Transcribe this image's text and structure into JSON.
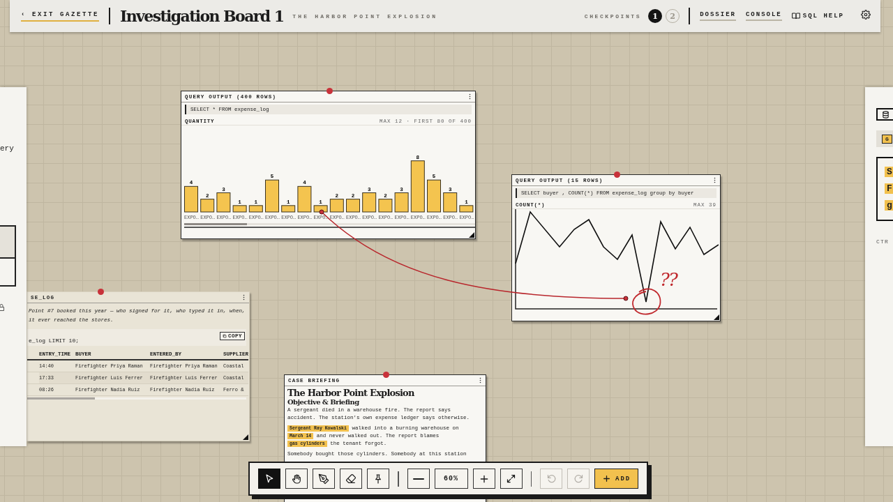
{
  "top_bar": {
    "back_link": "‹ EXIT GAZETTE",
    "title": "Investigation Board 1",
    "subtitle": "THE HARBOR POINT EXPLOSION",
    "checkpoints_label": "CHECKPOINTS",
    "checkpoints": [
      {
        "label": "1",
        "kind": "current"
      },
      {
        "label": "2",
        "kind": "pending"
      }
    ],
    "nav": [
      {
        "label": "DOSSIER",
        "kind": "link"
      },
      {
        "label": "CONSOLE",
        "kind": "link"
      },
      {
        "label": "SQL HELP",
        "kind": "help"
      }
    ]
  },
  "left_sheet": {
    "text": "ery"
  },
  "windows": [
    {
      "kind": "bar_chart",
      "title": "QUERY OUTPUT (400 ROWS)",
      "query": "SELECT * FROM expense_log",
      "note": "MAX 12 · FIRST 80 OF 400",
      "chart_data": {
        "type": "bar",
        "title": "QUANTITY",
        "categories": [
          "EXPO…",
          "EXPO…",
          "EXPO…",
          "EXPO…",
          "EXPO…",
          "EXPO…",
          "EXPO…",
          "EXPO…",
          "EXPO…",
          "EXPO…",
          "EXPO…",
          "EXPO…",
          "EXPO…",
          "EXPO…",
          "EXPO…",
          "EXPO…",
          "EXPO…",
          "EXPO…"
        ],
        "values": [
          4,
          2,
          3,
          1,
          1,
          5,
          1,
          4,
          1,
          2,
          2,
          3,
          2,
          3,
          8,
          5,
          3,
          1
        ],
        "data_labels": true
      }
    },
    {
      "kind": "line_chart",
      "title": "QUERY OUTPUT (15 ROWS)",
      "query": "SELECT buyer , COUNT(*) FROM expense_log group by buyer",
      "label": "COUNT(*)",
      "note": "MAX 39"
    },
    {
      "kind": "table",
      "title": "SE_LOG",
      "description": [
        "Point #7 booked this year — who signed for it, who typed it in, when,",
        "it ever reached the stores."
      ],
      "query": "e_log LIMIT 10;",
      "copy_button": "COPY",
      "columns": [
        "ENTRY_TIME",
        "BUYER",
        "ENTERED_BY",
        "SUPPLIER"
      ],
      "rows": [
        [
          "14:40",
          "Firefighter Priya Raman",
          "Firefighter Priya Raman",
          "Coastal"
        ],
        [
          "17:33",
          "Firefighter Luis Ferrer",
          "Firefighter Luis Ferrer",
          "Coastal"
        ],
        [
          "08:26",
          "Firefighter Nadia Ruiz",
          "Firefighter Nadia Ruiz",
          "Ferro &"
        ]
      ]
    },
    {
      "kind": "briefing",
      "title": "CASE BRIEFING",
      "heading": "The Harbor Point Explosion",
      "subheading": "Objective & Briefing",
      "paragraphs": [
        [
          {
            "text": "A sergeant died in a warehouse fire. The report says accident. The station's own expense ledger says otherwise.",
            "highlight": false
          }
        ],
        [
          {
            "text": "Sergeant Ray Kowalski",
            "highlight": true
          },
          {
            "text": " walked into a burning warehouse on ",
            "highlight": false
          },
          {
            "text": "March 14",
            "highlight": true
          },
          {
            "text": " and never walked out. The report blames ",
            "highlight": false
          },
          {
            "text": "gas cylinders",
            "highlight": true
          },
          {
            "text": " the tenant forgot.",
            "highlight": false
          }
        ],
        [
          {
            "text": "Somebody bought those cylinders. Somebody at this station",
            "highlight": false
          }
        ]
      ]
    }
  ],
  "annotation": {
    "note": "??"
  },
  "right_sheet": {
    "chip": "G",
    "highlights": [
      "S",
      "F",
      "g"
    ],
    "hint": "CTR"
  },
  "toolbar": {
    "tools": [
      {
        "kind": "select",
        "selected": true
      },
      {
        "kind": "hand",
        "selected": false
      },
      {
        "kind": "pen",
        "selected": false
      },
      {
        "kind": "eraser",
        "selected": false
      },
      {
        "kind": "pin",
        "selected": false
      }
    ],
    "zoom": "60%",
    "history": [
      {
        "kind": "undo",
        "disabled": true
      },
      {
        "kind": "redo",
        "disabled": true
      }
    ],
    "add_label": "ADD"
  }
}
